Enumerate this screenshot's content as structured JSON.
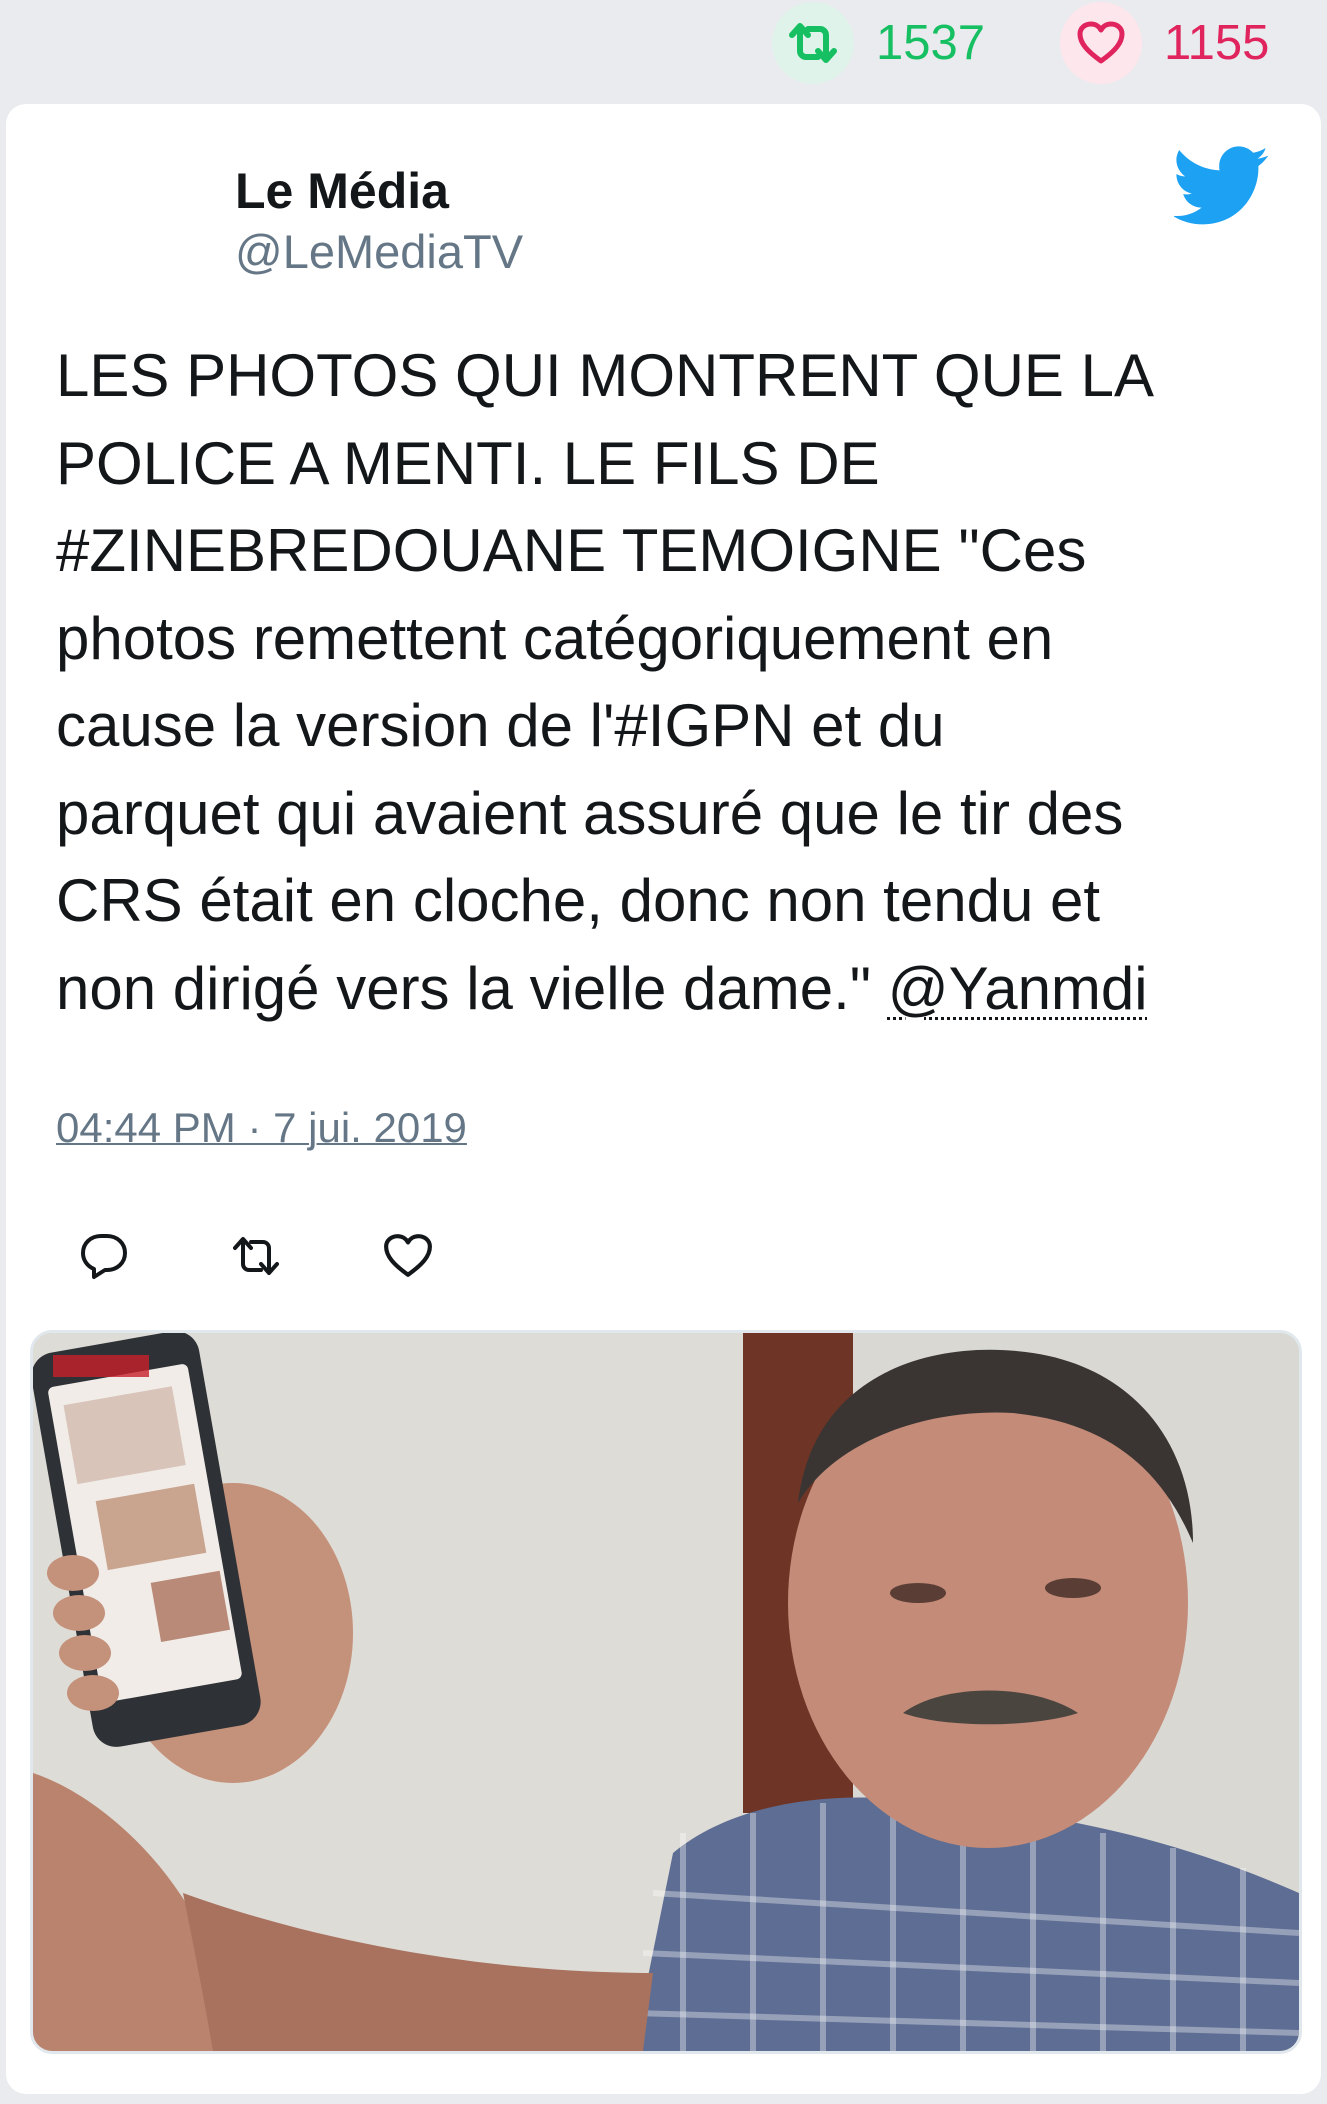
{
  "stats": {
    "retweets": "1537",
    "likes": "1155",
    "retweet_icon": "retweet-icon",
    "like_icon": "heart-icon"
  },
  "tweet": {
    "author_name": "Le Média",
    "author_handle": "@LeMediaTV",
    "text_main": "LES PHOTOS QUI MONTRENT QUE LA\nPOLICE A MENTI. LE FILS DE\n#ZINEBREDOUANE TEMOIGNE \"Ces\nphotos remettent catégoriquement en\ncause la version de l'#IGPN et du\nparquet qui avaient assuré que le tir des\nCRS était en cloche, donc non tendu et\nnon dirigé vers la vielle dame.\" ",
    "mention": "@Yanmdi",
    "timestamp": "04:44 PM · 7 jui. 2019"
  },
  "actions": [
    "reply-icon",
    "retweet-icon",
    "like-icon"
  ],
  "colors": {
    "retweet_green": "#17bf63",
    "like_red": "#e0245e",
    "twitter_blue": "#1da1f2",
    "muted_gray": "#657786",
    "background": "#e9ebee"
  }
}
